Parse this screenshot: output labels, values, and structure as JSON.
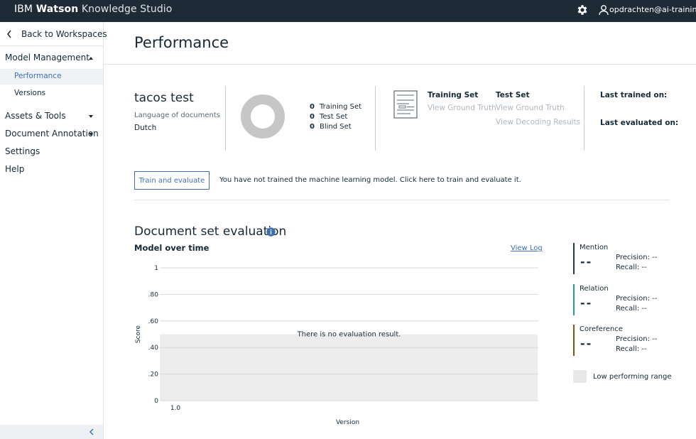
{
  "app": {
    "brand_ibm": "IBM",
    "brand_watson": "Watson",
    "brand_rest": "Knowledge Studio",
    "user_email": "opdrachten@ai-training.nl"
  },
  "sidebar": {
    "back_label": "Back to Workspaces",
    "model_management": "Model Management",
    "performance": "Performance",
    "versions": "Versions",
    "assets_tools": "Assets & Tools",
    "document_annotation": "Document Annotation",
    "settings": "Settings",
    "help": "Help"
  },
  "page": {
    "title": "Performance"
  },
  "project": {
    "name": "tacos test",
    "language_label": "Language of documents",
    "language_value": "Dutch",
    "counts": [
      {
        "num": "0",
        "label": "Training Set"
      },
      {
        "num": "0",
        "label": "Test Set"
      },
      {
        "num": "0",
        "label": "Blind Set"
      }
    ],
    "training_set_title": "Training Set",
    "training_view_gt": "View Ground Truth",
    "test_set_title": "Test Set",
    "test_view_gt": "View Ground Truth",
    "test_view_decoding": "View Decoding Results",
    "last_trained": "Last trained on:",
    "last_evaluated": "Last evaluated on:"
  },
  "train": {
    "button": "Train and evaluate",
    "message": "You have not trained the machine learning model. Click here to train and evaluate it."
  },
  "evaluation": {
    "title": "Document set evaluation",
    "model_over_time": "Model over time",
    "view_log": "View Log",
    "no_result": "There is no evaluation result.",
    "low_range": "Low performing range"
  },
  "metrics": [
    {
      "name": "Mention",
      "value": "--",
      "precision": "Precision:  --",
      "recall": "Recall:  --"
    },
    {
      "name": "Relation",
      "value": "--",
      "precision": "Precision:  --",
      "recall": "Recall:  --"
    },
    {
      "name": "Coreference",
      "value": "--",
      "precision": "Precision:  --",
      "recall": "Recall:  --"
    }
  ],
  "chart_data": {
    "type": "line",
    "title": "Model over time",
    "xlabel": "Version",
    "ylabel": "Score",
    "x": [
      "1.0"
    ],
    "ylim": [
      0,
      1
    ],
    "yticks": [
      "0",
      ".20",
      ".40",
      ".60",
      ".80",
      "1"
    ],
    "series": [],
    "low_performing_range": [
      0,
      0.5
    ],
    "grid": true,
    "annotation": "There is no evaluation result."
  }
}
